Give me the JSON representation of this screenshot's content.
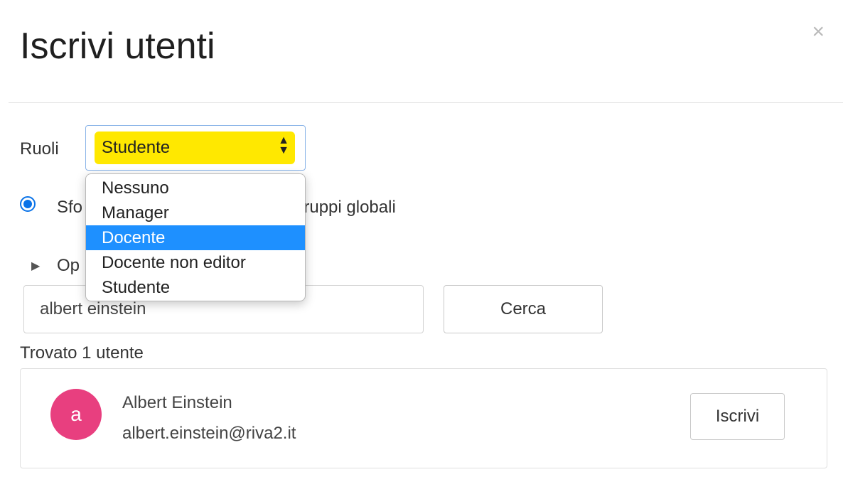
{
  "modal": {
    "title": "Iscrivi utenti",
    "close_symbol": "×"
  },
  "roles": {
    "label": "Ruoli",
    "selected_value": "Studente",
    "options": [
      {
        "label": "Nessuno"
      },
      {
        "label": "Manager"
      },
      {
        "label": "Docente",
        "highlighted": true
      },
      {
        "label": "Docente non editor"
      },
      {
        "label": "Studente"
      }
    ],
    "highlight_color": "#ffe800"
  },
  "radio": {
    "label_prefix": "Sfo",
    "label_suffix": "gruppi globali"
  },
  "options_section": {
    "label": "Op"
  },
  "search": {
    "value": "albert einstein",
    "button_label": "Cerca"
  },
  "results": {
    "count_text": "Trovato 1 utente",
    "users": [
      {
        "initial": "a",
        "name": "Albert Einstein",
        "email": "albert.einstein@riva2.it",
        "action_label": "Iscrivi"
      }
    ]
  },
  "colors": {
    "accent": "#1e90ff",
    "avatar": "#e83f7f",
    "radio": "#0a73e8"
  }
}
